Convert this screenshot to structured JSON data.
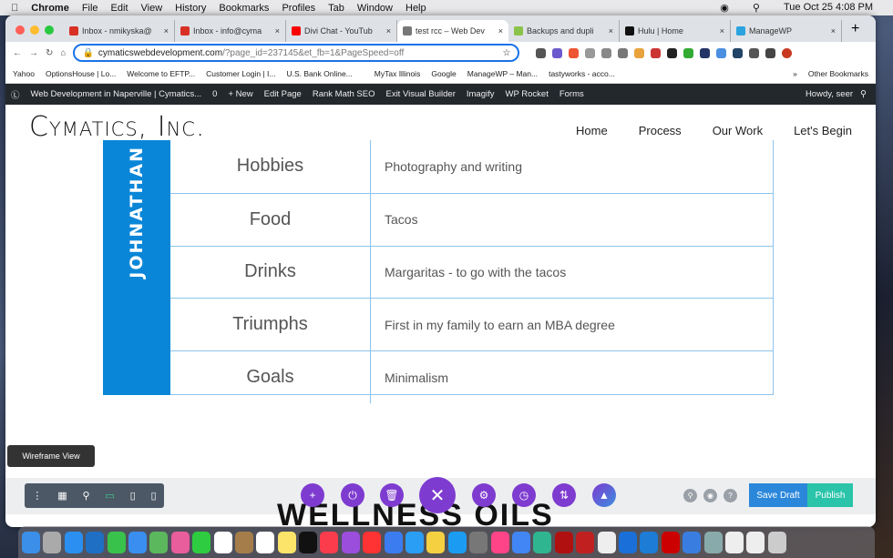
{
  "menubar": {
    "app": "Chrome",
    "items": [
      "File",
      "Edit",
      "View",
      "History",
      "Bookmarks",
      "Profiles",
      "Tab",
      "Window",
      "Help"
    ],
    "clock": "Tue Oct 25  4:08 PM"
  },
  "tabs": [
    {
      "label": "Inbox - nmikyska@",
      "color": "#d93025"
    },
    {
      "label": "Inbox - info@cyma",
      "color": "#d93025"
    },
    {
      "label": "Divi Chat - YouTub",
      "color": "#ff0000"
    },
    {
      "label": "test rcc – Web Dev",
      "color": "#777",
      "active": true
    },
    {
      "label": "Backups and dupli",
      "color": "#8bc34a"
    },
    {
      "label": "Hulu | Home",
      "color": "#111"
    },
    {
      "label": "ManageWP",
      "color": "#2aa3e0"
    }
  ],
  "address": {
    "domain": "cymaticswebdevelopment.com",
    "path": "/?page_id=237145&et_fb=1&PageSpeed=off"
  },
  "bookmarks": [
    "Yahoo",
    "OptionsHouse | Lo...",
    "Welcome to EFTP...",
    "Customer Login | I...",
    "U.S. Bank Online...",
    "",
    "MyTax Illinois",
    "Google",
    "ManageWP – Man...",
    "tastyworks - acco...",
    "»",
    "Other Bookmarks"
  ],
  "wpbar": {
    "items": [
      "Web Development in Naperville | Cymatics...",
      "0",
      "+ New",
      "Edit Page",
      "Rank Math SEO",
      "Exit Visual Builder",
      "Imagify",
      "WP Rocket",
      "Forms"
    ],
    "howdy": "Howdy, seer"
  },
  "site": {
    "logo": "Cymatics, Inc.",
    "nav": [
      "Home",
      "Process",
      "Our Work",
      "Let's Begin"
    ],
    "name": "JOHNATHAN",
    "accent": "#0a86d8",
    "rows": [
      {
        "k": "Hobbies",
        "v": "Photography and writing"
      },
      {
        "k": "Food",
        "v": "Tacos"
      },
      {
        "k": "Drinks",
        "v": "Margaritas - to go with the tacos"
      },
      {
        "k": "Triumphs",
        "v": "First in my family to earn an MBA degree"
      },
      {
        "k": "Goals",
        "v": "Minimalism"
      }
    ],
    "next_heading": "WELLNESS OILS"
  },
  "divi": {
    "tooltip": "Wireframe View",
    "save": "Save Draft",
    "publish": "Publish"
  },
  "dock_colors": [
    "#3b8fe8",
    "#aaa",
    "#2a8ff0",
    "#1f6fc4",
    "#39c24b",
    "#3a8ef0",
    "#5cb85c",
    "#e85d9c",
    "#2ecc40",
    "#fff",
    "#a57d4a",
    "#fff",
    "#fce36a",
    "#111",
    "#fa3c4c",
    "#9b4ddb",
    "#f33",
    "#3b7cf0",
    "#2a9df4",
    "#f5d142",
    "#1b9cf2",
    "#777",
    "#f48",
    "#4285f4",
    "#2fb58f",
    "#b01010",
    "#c02020",
    "#eee",
    "#1a6fd8",
    "#1c7cd6",
    "#c00",
    "#3a7de0",
    "#8aa",
    "#eee",
    "#eee",
    "#ccc"
  ]
}
